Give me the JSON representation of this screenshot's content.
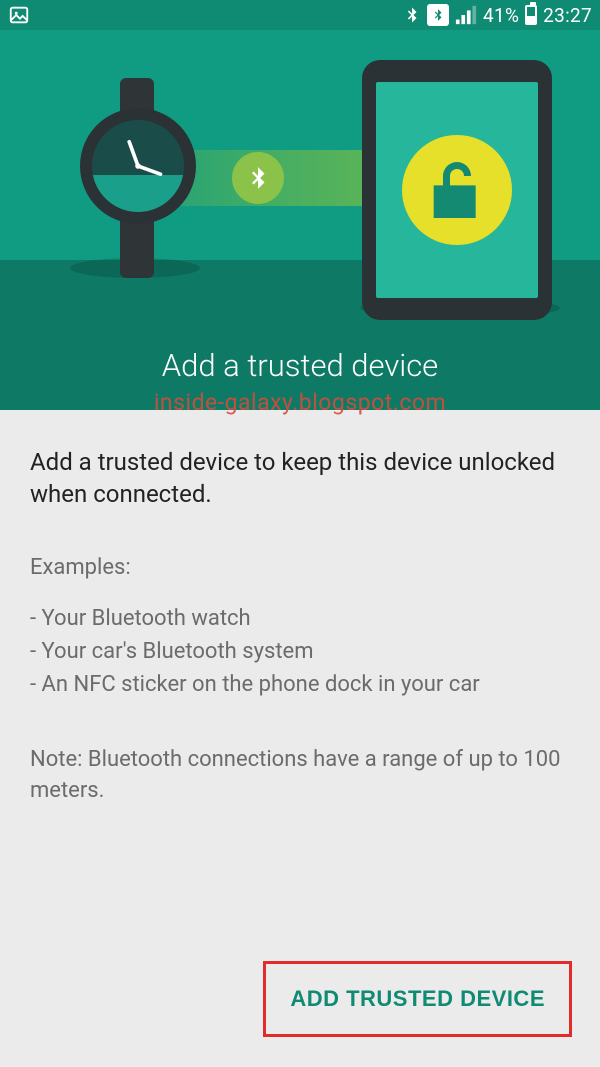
{
  "status": {
    "battery": "41%",
    "time": "23:27"
  },
  "header": {
    "title": "Add a trusted device",
    "watermark": "inside-galaxy.blogspot.com"
  },
  "content": {
    "lead": "Add a trusted device to keep this device unlocked when connected.",
    "examples_label": "Examples:",
    "examples": [
      "- Your Bluetooth watch",
      "- Your car's Bluetooth system",
      "- An NFC sticker on the phone dock in your car"
    ],
    "note": "Note: Bluetooth connections have a range of up to 100 meters."
  },
  "actions": {
    "add_trusted_device": "ADD TRUSTED DEVICE"
  },
  "colors": {
    "primary": "#0f8a73",
    "hero": "#109c82",
    "hero_dark": "#0e7a66",
    "accent_yellow": "#e6e02a",
    "highlight_border": "#e22b2b"
  }
}
